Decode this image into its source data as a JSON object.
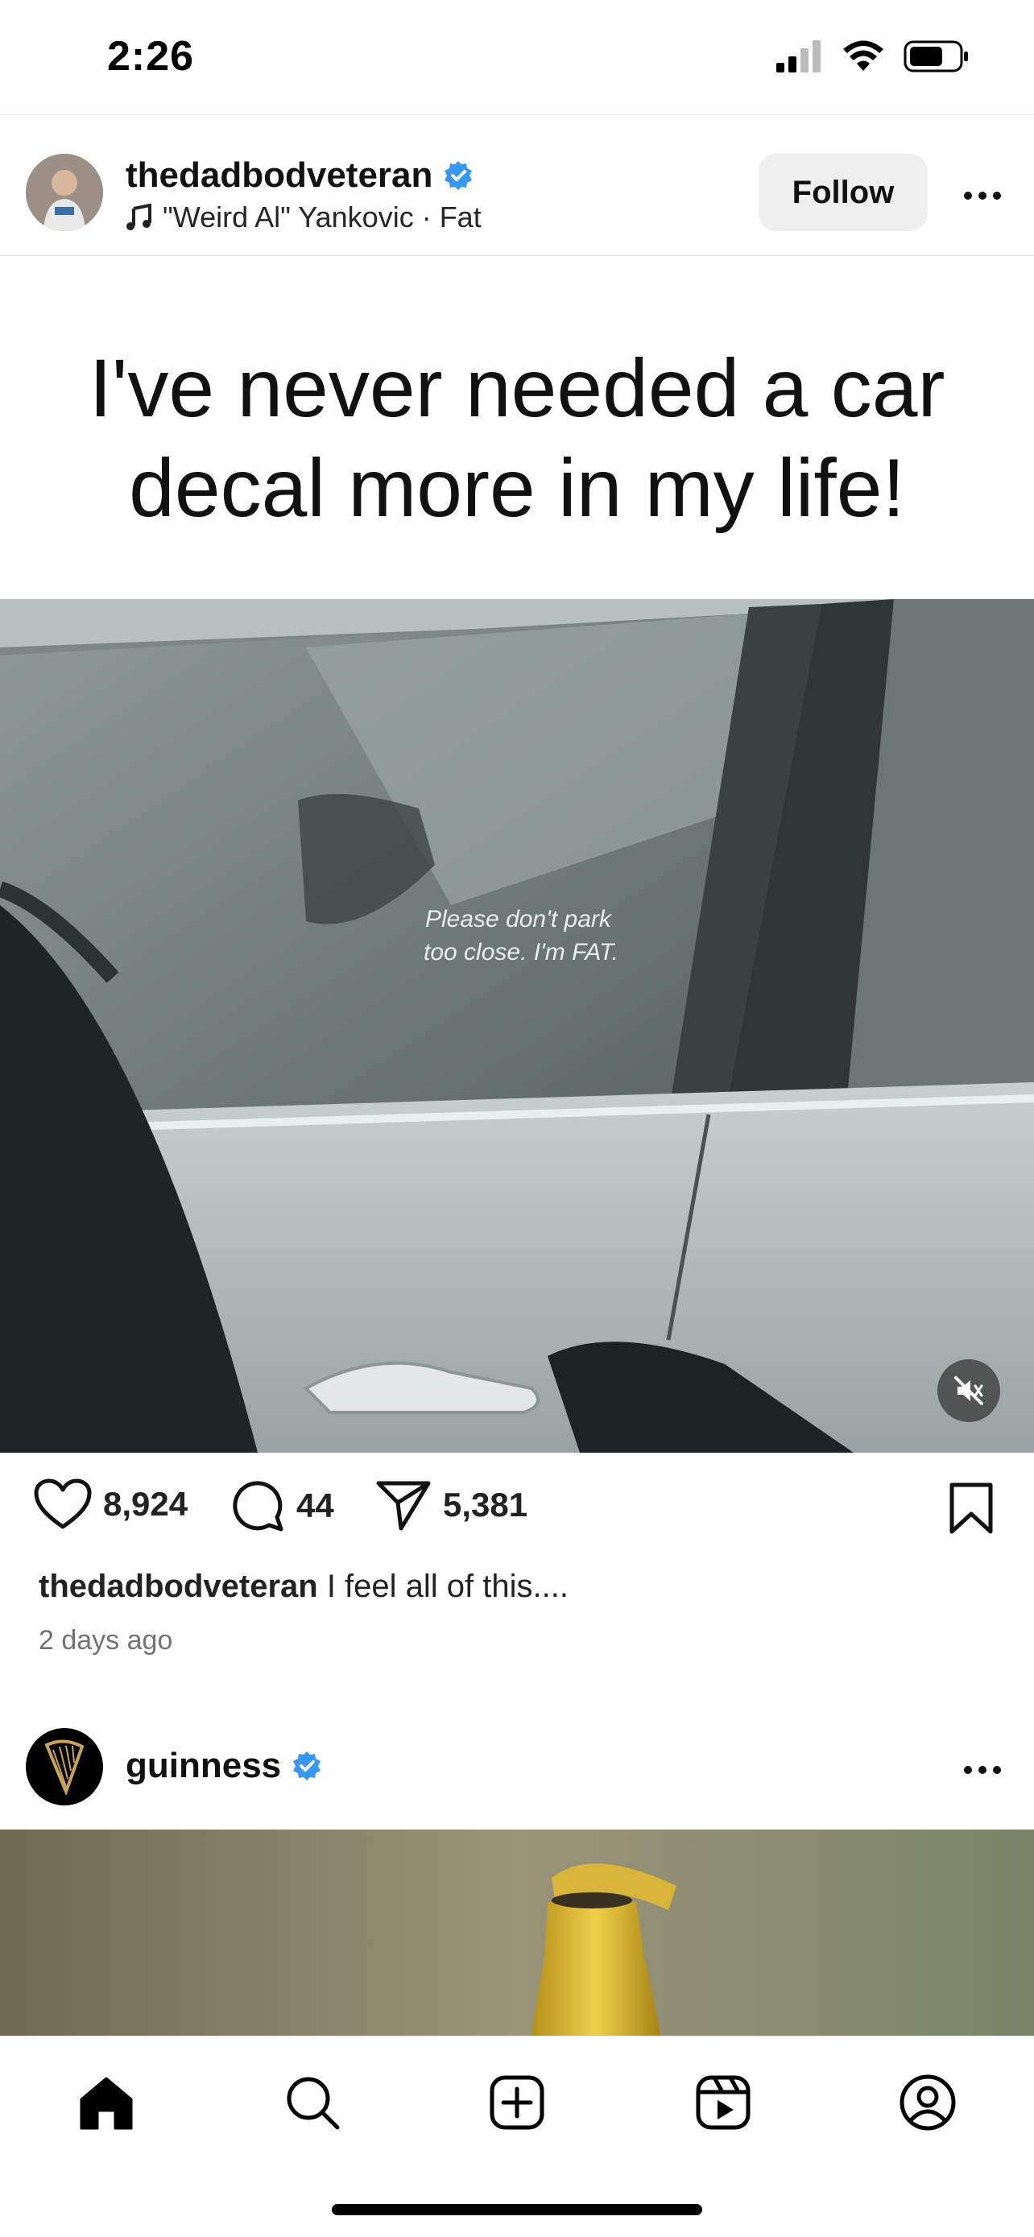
{
  "status_bar": {
    "time": "2:26",
    "icons": [
      "cellular-signal-icon",
      "wifi-icon",
      "battery-icon"
    ]
  },
  "post": {
    "username": "thedadbodveteran",
    "verified": true,
    "audio": "\"Weird Al\" Yankovic · Fat",
    "follow_label": "Follow",
    "title_line1": "I've never needed a car",
    "title_line2": "decal more in my life!",
    "decal_line1": "Please don't park",
    "decal_line2": "too close. I'm FAT.",
    "likes": "8,924",
    "comments": "44",
    "shares": "5,381",
    "caption_user": "thedadbodveteran",
    "caption_text": " I feel all of this....",
    "timestamp": "2 days ago"
  },
  "next_post": {
    "username": "guinness",
    "verified": true
  },
  "tab_bar": {
    "items": [
      "home-icon",
      "search-icon",
      "create-icon",
      "reels-icon",
      "profile-icon"
    ]
  },
  "colors": {
    "verified_blue": "#3897f0",
    "follow_bg": "#efefef",
    "muted_text": "#737373"
  }
}
